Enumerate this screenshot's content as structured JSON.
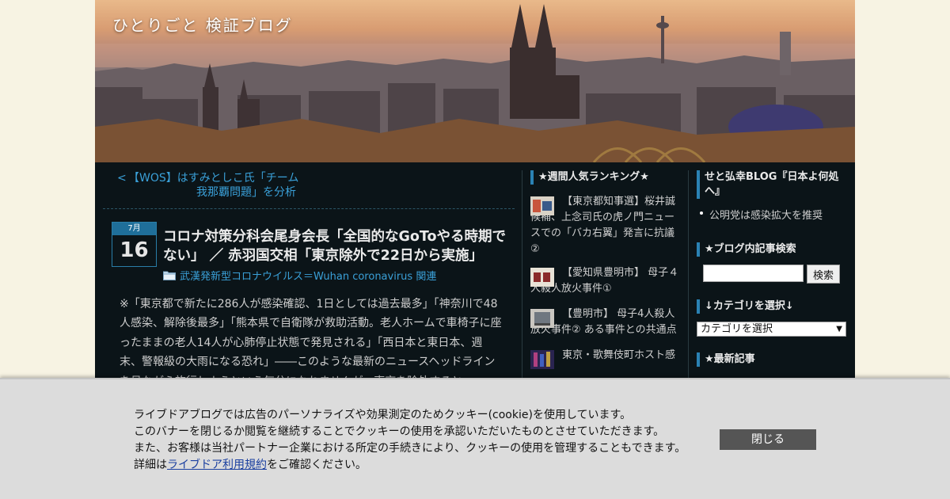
{
  "site": {
    "title": "ひとりごと 検証ブログ"
  },
  "prev_link": {
    "arrow": "<",
    "line1": "【WOS】はすみとしこ氏「チーム",
    "line2": "我那覇問題」を分析"
  },
  "post": {
    "month": "7月",
    "day": "16",
    "title": "コロナ対策分科会尾身会長「全国的なGoToやる時期でない」 ／ 赤羽国交相「東京除外で22日から実施」",
    "category": "武漢発新型コロナウイルス＝Wuhan coronavirus 関連",
    "body": "※「東京都で新たに286人が感染確認、1日としては過去最多」「神奈川で48人感染、解除後最多」「熊本県で自衛隊が救助活動。老人ホームで車椅子に座ったままの老人14人が心肺停止状態で発見される」「西日本と東日本、週末、警報級の大雨になる恐れ」――このような最新のニュースヘッドラインを見ながら旅行しようという気分になれませんが、東京を除外すると"
  },
  "ranking": {
    "heading": "★週間人気ランキング★",
    "items": [
      {
        "text": "【東京都知事選】桜井誠候補、上念司氏の虎ノ門ニュースでの「バカ右翼」発言に抗議②",
        "thumb": "thumb-1"
      },
      {
        "text": "【愛知県豊明市】 母子４人殺人放火事件①",
        "thumb": "thumb-2"
      },
      {
        "text": "【豊明市】 母子4人殺人放火事件② ある事件との共通点",
        "thumb": "thumb-3"
      },
      {
        "text": "東京・歌舞伎町ホスト感",
        "thumb": "thumb-4"
      }
    ]
  },
  "right_sidebar": {
    "blog_heading": "せと弘幸BLOG『日本よ何処へ』",
    "blog_item": "公明党は感染拡大を推奨",
    "search_heading": "★ブログ内記事検索",
    "search_button": "検索",
    "search_value": "",
    "category_heading": "↓カテゴリを選択↓",
    "category_selected": "カテゴリを選択",
    "latest_heading": "★最新記事"
  },
  "cookie": {
    "line1": "ライブドアブログでは広告のパーソナライズや効果測定のためクッキー(cookie)を使用しています。",
    "line2": "このバナーを閉じるか閲覧を継続することでクッキーの使用を承認いただいたものとさせていただきます。",
    "line3": "また、お客様は当社パートナー企業における所定の手続きにより、クッキーの使用を管理することもできます。",
    "line4_prefix": "詳細は",
    "line4_link": "ライブドア利用規約",
    "line4_suffix": "をご確認ください。",
    "close_label": "閉じる"
  },
  "colors": {
    "accent": "#3aa0d8",
    "background": "#0b1418",
    "page_bg": "#f7f3e3",
    "banner_bg": "#dcdcdc"
  }
}
